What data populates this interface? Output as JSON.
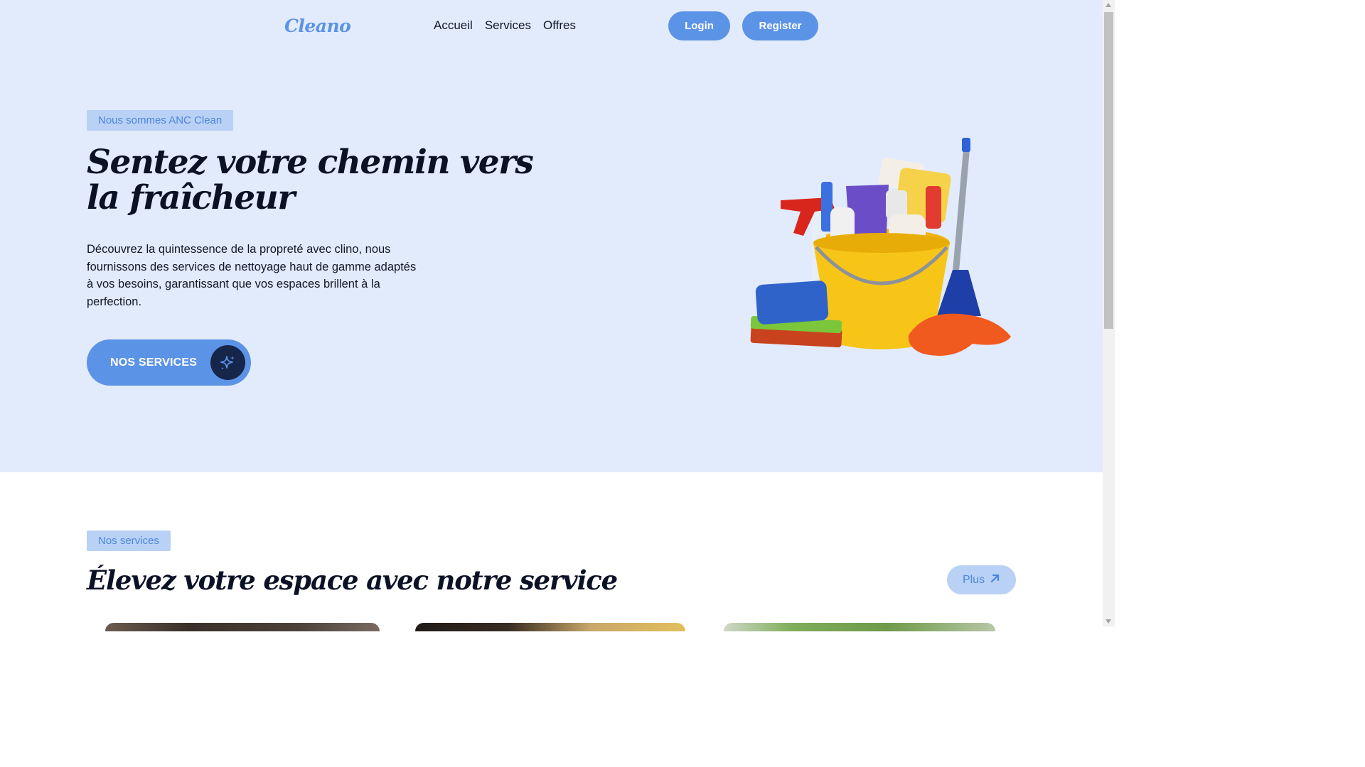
{
  "header": {
    "logo": "Cleano",
    "nav": [
      "Accueil",
      "Services",
      "Offres"
    ],
    "login_label": "Login",
    "register_label": "Register"
  },
  "hero": {
    "tag": "Nous sommes ANC Clean",
    "title": "Sentez votre chemin vers la fraîcheur",
    "description": "Découvrez la quintessence de la propreté avec clino, nous fournissons des services de nettoyage haut de gamme adaptés à vos besoins, garantissant que vos espaces brillent à la perfection.",
    "cta_label": "NOS SERVICES",
    "cta_icon": "sparkle-icon",
    "illustration": "cleaning-supplies-bucket"
  },
  "services": {
    "tag": "Nos services",
    "title": "Élevez votre espace avec notre service",
    "more_label": "Plus",
    "more_icon": "arrow-up-right-icon"
  },
  "colors": {
    "accent": "#5b93e6",
    "hero_background": "#e2ebfb",
    "tag_background": "#b9d1f5",
    "dark": "#16254a"
  }
}
